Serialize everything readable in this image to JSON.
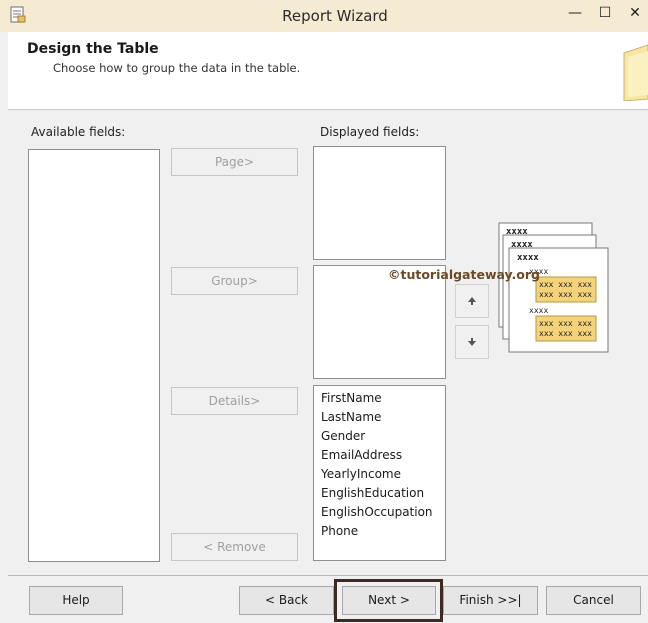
{
  "window": {
    "title": "Report Wizard",
    "minimize_glyph": "—",
    "maximize_glyph": "☐",
    "close_glyph": "✕"
  },
  "header": {
    "title": "Design the Table",
    "subtitle": "Choose how to group the data in the table."
  },
  "available": {
    "label": "Available fields:",
    "items": []
  },
  "displayed": {
    "label": "Displayed fields:"
  },
  "page_list": {
    "items": []
  },
  "group_list": {
    "items": []
  },
  "details_list": {
    "items": [
      "FirstName",
      "LastName",
      "Gender",
      "EmailAddress",
      "YearlyIncome",
      "EnglishEducation",
      "EnglishOccupation",
      "Phone"
    ]
  },
  "actions": {
    "page": "Page>",
    "group": "Group>",
    "details": "Details>",
    "remove": "< Remove"
  },
  "preview": {
    "header_token": "xxxx",
    "group_token": "xxxx",
    "detail_token": "xxx xxx xxx"
  },
  "watermark": "©tutorialgateway.org",
  "footer": {
    "help": "Help",
    "back": "< Back",
    "next": "Next >",
    "finish": "Finish >>|",
    "cancel": "Cancel"
  },
  "colors": {
    "titlebar": "#f4ebd2",
    "detail_highlight": "#f3d27a",
    "focus_border": "#3b2a26"
  }
}
